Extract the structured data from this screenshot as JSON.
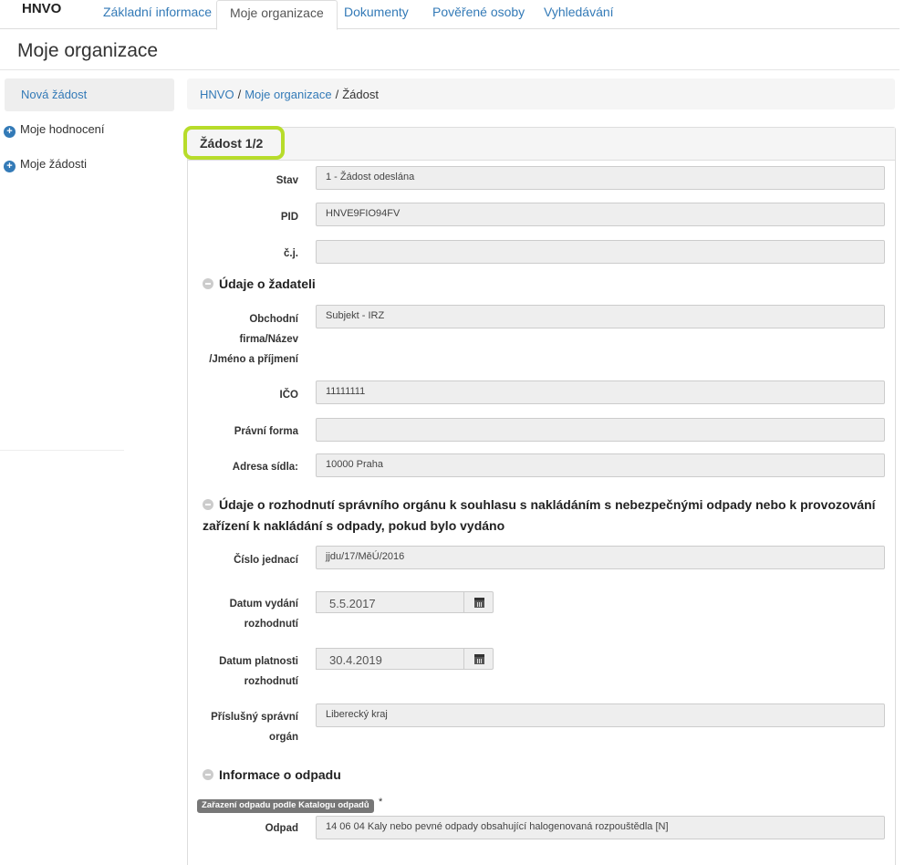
{
  "brand": "HNVO",
  "nav": {
    "tabs": [
      "Základní informace",
      "Moje organizace",
      "Dokumenty",
      "Pověřené osoby",
      "Vyhledávání"
    ],
    "active": "Moje organizace"
  },
  "page_title": "Moje organizace",
  "sidebar": {
    "items": [
      "Nová žádost",
      "Moje hodnocení",
      "Moje žádosti"
    ]
  },
  "breadcrumb": {
    "items": [
      "HNVO",
      "Moje organizace",
      "Žádost"
    ],
    "separator": "/"
  },
  "panel": {
    "title": "Žádost 1/2"
  },
  "fields": {
    "stav": {
      "label": "Stav",
      "value": "1 - Žádost odeslána"
    },
    "pid": {
      "label": "PID",
      "value": "HNVE9FIO94FV"
    },
    "cj": {
      "label": "č.j.",
      "value": ""
    },
    "obchodni_firma": {
      "label_lines": [
        "Obchodní",
        "firma/Název",
        "/Jméno a příjmení"
      ],
      "value": "Subjekt - IRZ"
    },
    "ico": {
      "label": "IČO",
      "value": "11111111"
    },
    "pravni_forma": {
      "label": "Právní forma",
      "value": ""
    },
    "adresa": {
      "label": "Adresa sídla:",
      "value": "10000 Praha"
    },
    "cislo_jednaci": {
      "label": "Číslo jednací",
      "value": "jjdu/17/MěÚ/2016"
    },
    "datum_vydani": {
      "label_lines": [
        "Datum vydání",
        "rozhodnutí"
      ],
      "value": "5.5.2017"
    },
    "datum_platnosti": {
      "label_lines": [
        "Datum platnosti",
        "rozhodnutí"
      ],
      "value": "30.4.2019"
    },
    "spravni_organ": {
      "label_lines": [
        "Příslušný správní",
        "orgán"
      ],
      "value": "Liberecký kraj"
    },
    "odpad": {
      "label": "Odpad",
      "value": "14 06 04 Kaly nebo pevné odpady obsahující halogenovaná rozpouštědla [N]"
    }
  },
  "sections": {
    "zadatel": "Údaje o žadateli",
    "rozhodnuti_line1": "Údaje o rozhodnutí správního orgánu k souhlasu s nakládáním s nebezpečnými odpady nebo k provozování",
    "rozhodnuti_line2": "zařízení k nakládání s odpady, pokud bylo vydáno",
    "odpad": "Informace o odpadu"
  },
  "badge": "Zařazení odpadu podle Katalogu odpadů",
  "required_mark": "*"
}
